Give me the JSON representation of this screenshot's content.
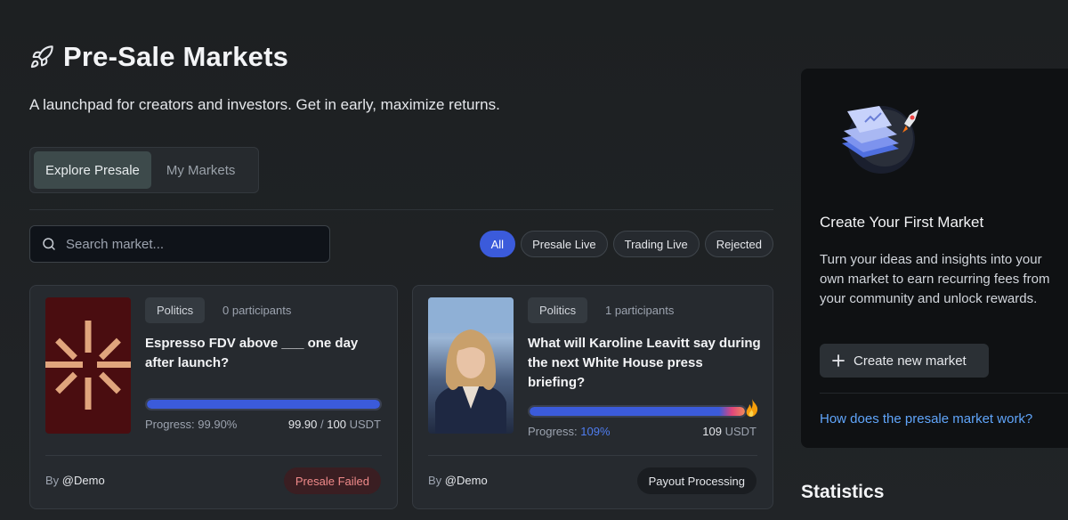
{
  "header": {
    "title": "Pre-Sale Markets",
    "title_icon": "rocket-icon",
    "subtitle": "A launchpad for creators and investors. Get in early, maximize returns."
  },
  "tabs": [
    {
      "label": "Explore Presale",
      "active": true
    },
    {
      "label": "My Markets",
      "active": false
    }
  ],
  "search": {
    "placeholder": "Search market..."
  },
  "filters": [
    {
      "label": "All",
      "active": true
    },
    {
      "label": "Presale Live",
      "active": false
    },
    {
      "label": "Trading Live",
      "active": false
    },
    {
      "label": "Rejected",
      "active": false
    }
  ],
  "cards": [
    {
      "category": "Politics",
      "participants": "0 participants",
      "question": "Espresso FDV above ___ one day after launch?",
      "progress_label": "Progress:",
      "progress_percent": "99.90%",
      "progress_value": "99.90",
      "progress_sep": "/",
      "progress_target": "100",
      "currency": "USDT",
      "progress_fraction": 0.999,
      "by_label": "By",
      "author": "@Demo",
      "status": "Presale Failed",
      "status_color": "#f08a8a"
    },
    {
      "category": "Politics",
      "participants": "1 participants",
      "question": "What will Karoline Leavitt say during the next White House press briefing?",
      "progress_label": "Progress:",
      "progress_percent": "109%",
      "progress_value": "109",
      "currency": "USDT",
      "progress_fraction": 1.0,
      "progress_icon": "flame-icon",
      "by_label": "By",
      "author": "@Demo",
      "status": "Payout Processing"
    }
  ],
  "sidebar": {
    "heading": "Create Your First Market",
    "body": "Turn your ideas and insights into your own market to earn recurring fees from your community and unlock rewards.",
    "create_button": "Create new market",
    "create_icon": "plus-icon",
    "help_link": "How does the presale market work?"
  },
  "statistics": {
    "heading": "Statistics"
  },
  "colors": {
    "accent": "#3b5bdb",
    "link": "#60a5fa",
    "failed": "#f08a8a"
  }
}
